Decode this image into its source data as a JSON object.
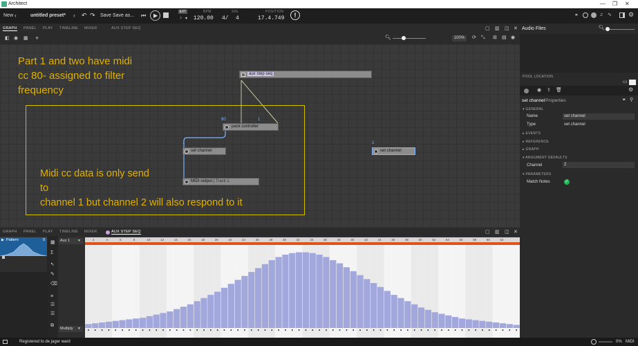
{
  "window": {
    "title": "Architect",
    "minimize": "—",
    "restore": "❐",
    "close": "✕"
  },
  "transport": {
    "new_label": "New",
    "preset_name": "untitled preset*",
    "save_label": "Save",
    "save_as_label": "Save as...",
    "ext_label": "EXT",
    "bpm_label": "BPM",
    "bpm_value": "120.00",
    "sig_label": "SIG",
    "sig_num": "4/",
    "sig_den": "4",
    "position_label": "POSITION",
    "position_value": "17.4.749",
    "icons": [
      "back-icon",
      "redo-icon",
      "skip-start-icon",
      "play-icon",
      "stop-icon",
      "alert-icon"
    ]
  },
  "graph_tabs": [
    "GRAPH",
    "PANEL",
    "PLAY",
    "TIMELINE",
    "MIXER",
    "AUX STEP SEQ"
  ],
  "zoom": "100%",
  "graph": {
    "notes": [
      "Part 1 and two have midi",
      "cc 80- assigned to filter",
      "frequency",
      "Midi cc data  is only send",
      "to",
      "channel 1    but channel 2 will also respond to it"
    ],
    "nodes": {
      "aux_step_seq": "aux step seq",
      "pack_controller": "pack controller",
      "set_channel_1": "set channel",
      "set_channel_2": "set channel",
      "midi_output": "MIDI output",
      "midi_output_sub": "| Track 1"
    },
    "port_labels": {
      "p80": "80",
      "p1": "1",
      "ch1": "1",
      "ch2": "2"
    }
  },
  "seq_tabs": [
    "GRAPH",
    "PANEL",
    "PLAY",
    "TIMELINE",
    "MIXER",
    "AUX STEP SEQ"
  ],
  "sequencer": {
    "pattern_label": "Pattern",
    "pattern_num": "0",
    "aux_select": "Aux 1",
    "multiply_select": "Multiply",
    "ruler": [
      "2",
      "4",
      "6",
      "8",
      "10",
      "12",
      "14",
      "16",
      "18",
      "20",
      "22",
      "24",
      "26",
      "28",
      "30",
      "32",
      "34",
      "36",
      "38",
      "40",
      "42",
      "44",
      "46",
      "48",
      "50",
      "52",
      "54",
      "56",
      "58",
      "60",
      "62"
    ],
    "step_values": [
      0.05,
      0.06,
      0.07,
      0.08,
      0.09,
      0.1,
      0.11,
      0.12,
      0.13,
      0.15,
      0.17,
      0.19,
      0.21,
      0.24,
      0.27,
      0.3,
      0.34,
      0.38,
      0.42,
      0.46,
      0.51,
      0.56,
      0.61,
      0.66,
      0.71,
      0.76,
      0.81,
      0.86,
      0.9,
      0.93,
      0.95,
      0.96,
      0.96,
      0.95,
      0.93,
      0.9,
      0.86,
      0.82,
      0.77,
      0.72,
      0.67,
      0.62,
      0.57,
      0.52,
      0.47,
      0.42,
      0.38,
      0.34,
      0.3,
      0.26,
      0.23,
      0.2,
      0.18,
      0.16,
      0.14,
      0.12,
      0.11,
      0.1,
      0.09,
      0.08,
      0.07,
      0.06,
      0.05,
      0.04
    ],
    "bar_color": "#a2a8dc"
  },
  "right_panel": {
    "title": "Audio Files",
    "pool_location_label": "POOL LOCATION",
    "properties_title": "set channel",
    "properties_suffix": "Properties",
    "sections": [
      "GENERAL",
      "EVENTS",
      "REFERENCE",
      "GRAPH",
      "ARGUMENT DEFAULTS",
      "PARAMETERS"
    ],
    "fields": {
      "name_label": "Name",
      "name_value": "set channel",
      "type_label": "Type",
      "type_value": "set channel",
      "channel_label": "Channel",
      "channel_value": "2",
      "match_notes_label": "Match Notes"
    }
  },
  "status": {
    "text": "Registered to de jager ward",
    "cpu": "0%",
    "midi": "MIDI"
  },
  "colors": {
    "note": "#e0b000",
    "accent": "#e0541c",
    "port": "#7fb4ff",
    "ok": "#1db954"
  }
}
